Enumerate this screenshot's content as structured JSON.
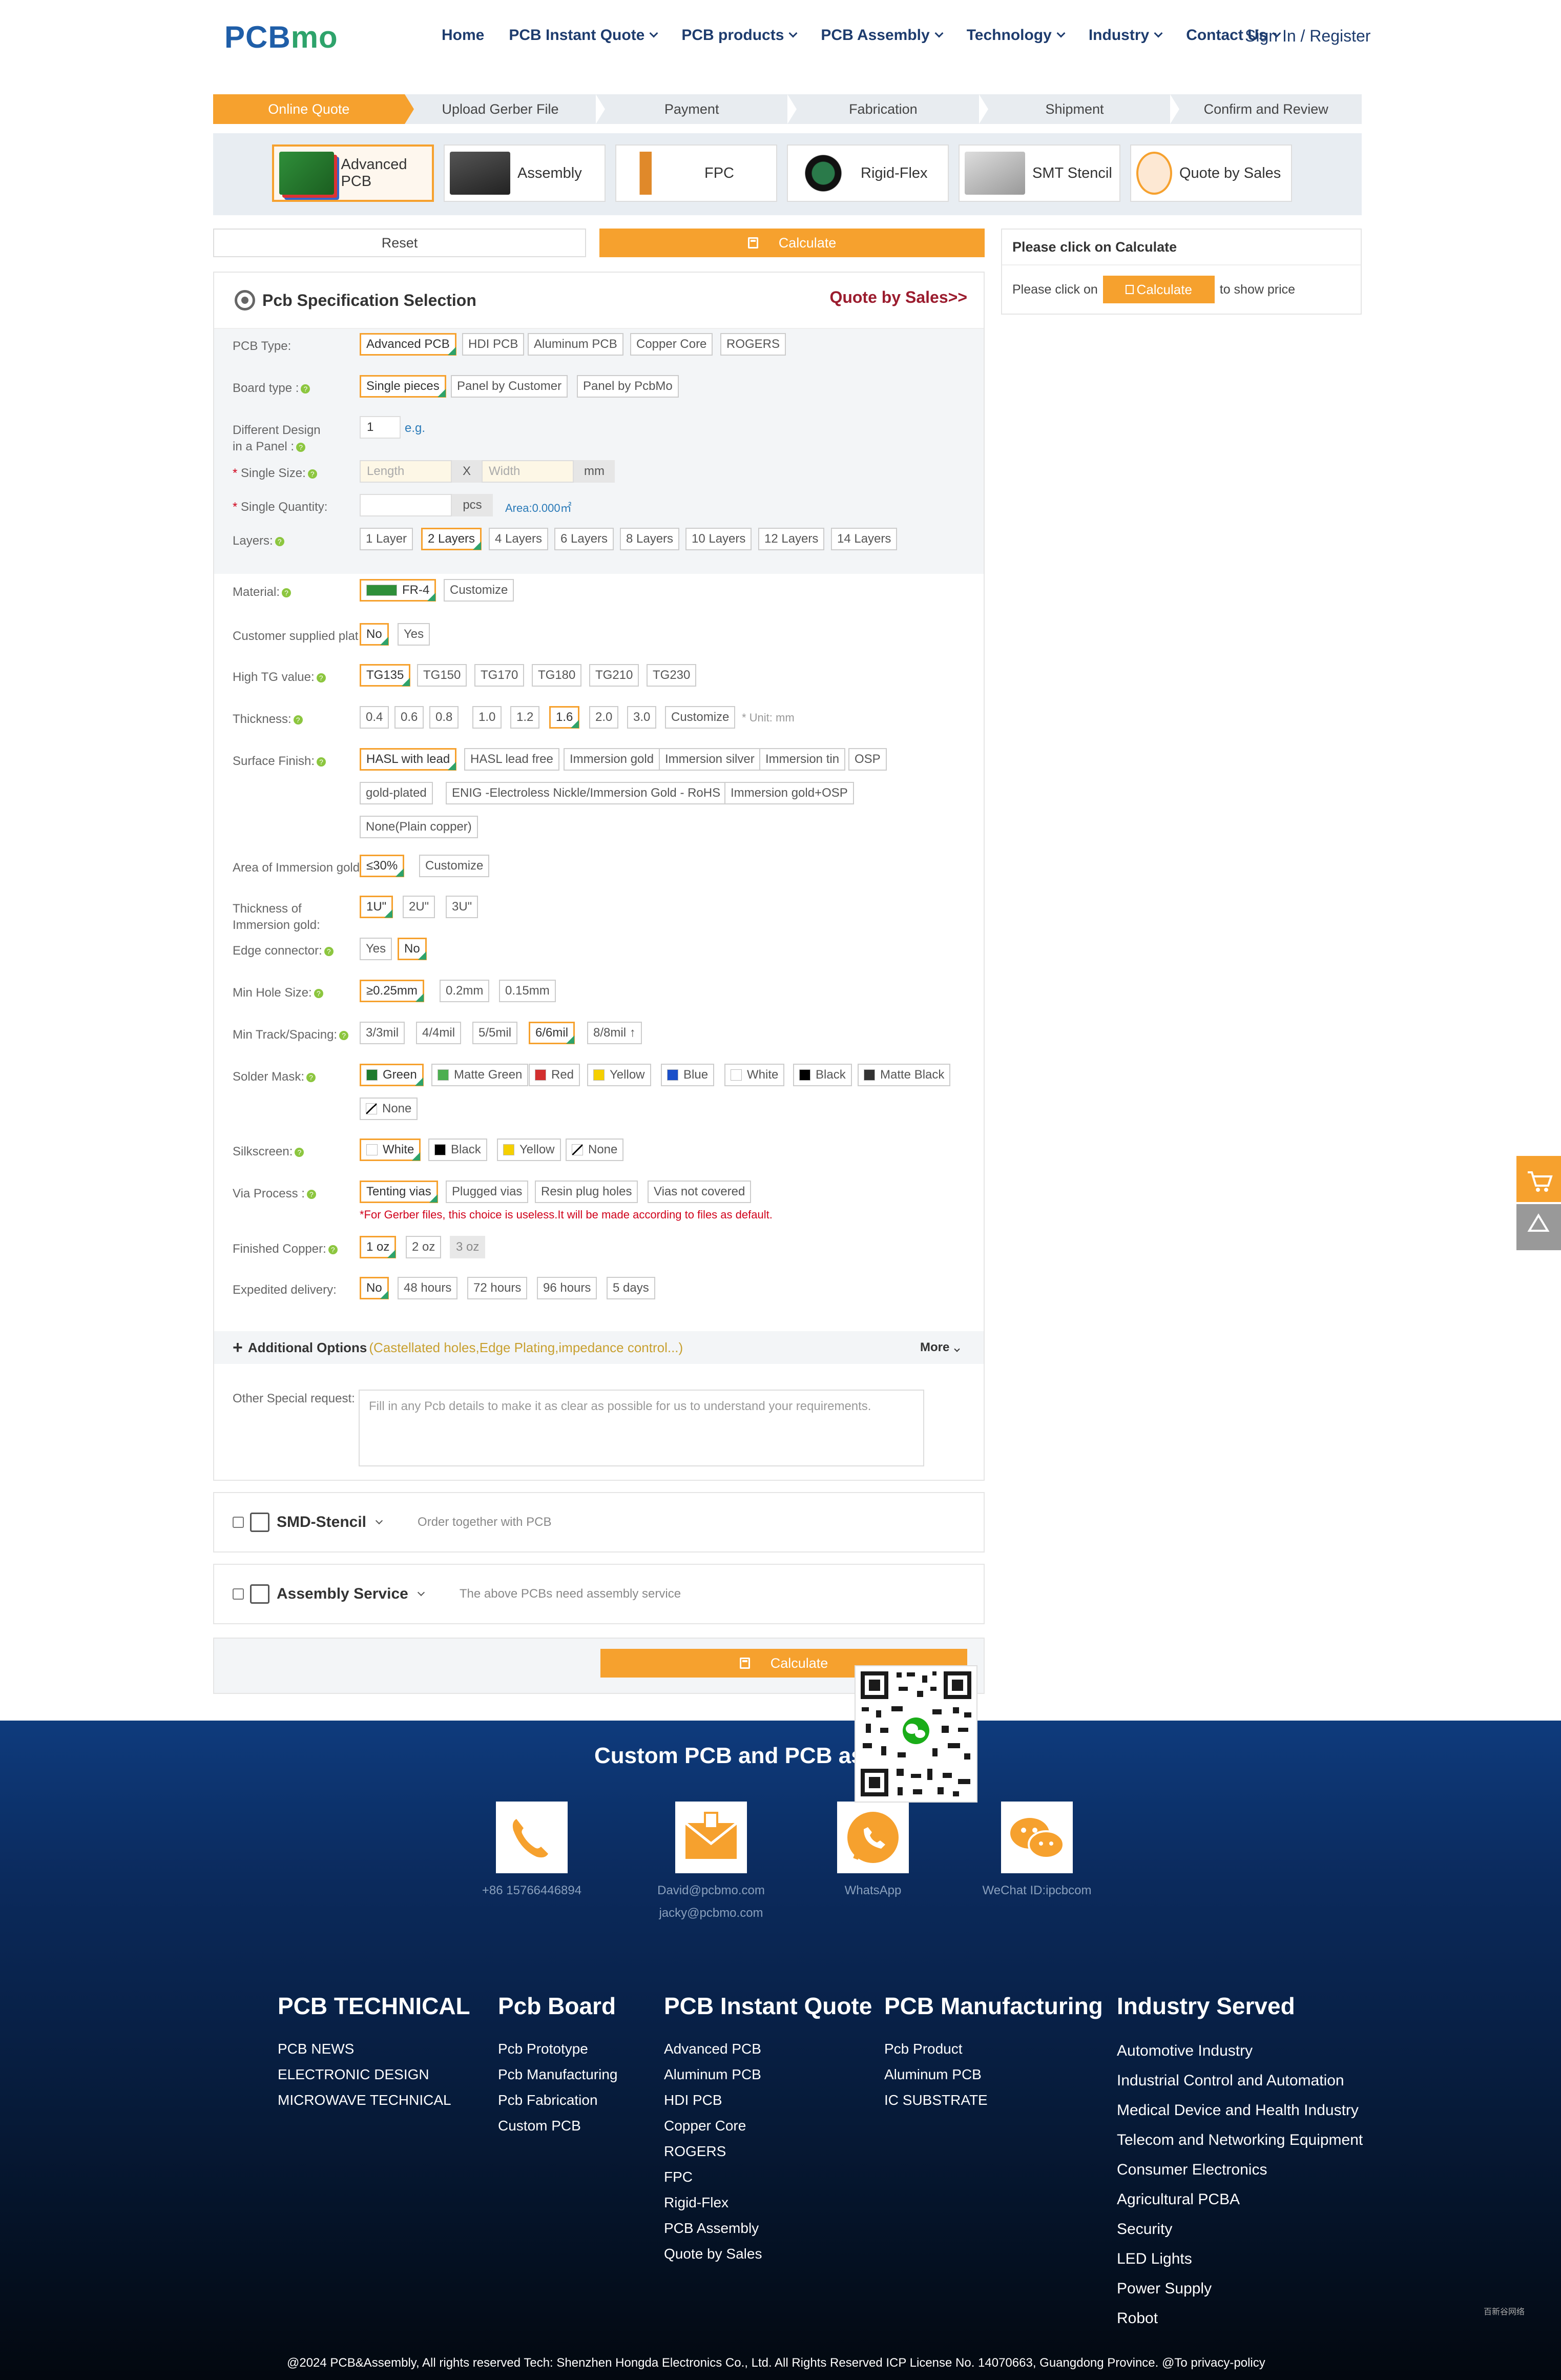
{
  "header": {
    "logo_a": "PCB",
    "logo_b": "mo",
    "nav": [
      "Home",
      "PCB Instant Quote",
      "PCB products",
      "PCB Assembly",
      "Technology",
      "Industry",
      "Contact Us"
    ],
    "signin": "Sign In / Register"
  },
  "steps": [
    "Online Quote",
    "Upload Gerber File",
    "Payment",
    "Fabrication",
    "Shipment",
    "Confirm and Review"
  ],
  "product_tabs": [
    "Advanced PCB",
    "Assembly",
    "FPC",
    "Rigid-Flex",
    "SMT Stencil",
    "Quote by Sales"
  ],
  "actions": {
    "reset": "Reset",
    "calculate": "Calculate"
  },
  "spec": {
    "title": "Pcb Specification Selection",
    "quote_by_sales": "Quote by Sales>>",
    "pcb_type": {
      "label": "PCB Type:",
      "options": [
        "Advanced PCB",
        "HDI PCB",
        "Aluminum PCB",
        "Copper Core",
        "ROGERS"
      ]
    },
    "board_type": {
      "label": "Board type :",
      "options": [
        "Single pieces",
        "Panel by Customer",
        "Panel by PcbMo"
      ]
    },
    "diff_design": {
      "label_1": "Different Design",
      "label_2": "in a Panel :",
      "value": "1",
      "eg": "e.g."
    },
    "single_size": {
      "label": "Single Size:",
      "length": "Length",
      "x": "X",
      "width": "Width",
      "unit": "mm"
    },
    "single_qty": {
      "label": "Single Quantity:",
      "unit": "pcs",
      "area": "Area:0.000㎡"
    },
    "layers": {
      "label": "Layers:",
      "options": [
        "1 Layer",
        "2 Layers",
        "4 Layers",
        "6 Layers",
        "8 Layers",
        "10 Layers",
        "12 Layers",
        "14 Layers"
      ]
    },
    "material": {
      "label": "Material:",
      "options": [
        "FR-4",
        "Customize"
      ]
    },
    "customer_plate": {
      "label": "Customer supplied plat",
      "options": [
        "No",
        "Yes"
      ]
    },
    "high_tg": {
      "label": "High TG value:",
      "options": [
        "TG135",
        "TG150",
        "TG170",
        "TG180",
        "TG210",
        "TG230"
      ]
    },
    "thickness": {
      "label": "Thickness:",
      "options": [
        "0.4",
        "0.6",
        "0.8",
        "1.0",
        "1.2",
        "1.6",
        "2.0",
        "3.0",
        "Customize"
      ],
      "note": "* Unit: mm"
    },
    "surface": {
      "label": "Surface Finish:",
      "options": [
        "HASL with lead",
        "HASL lead free",
        "Immersion gold",
        "Immersion silver",
        "Immersion tin",
        "OSP",
        "gold-plated",
        "ENIG -Electroless Nickle/Immersion Gold - RoHS",
        "Immersion gold+OSP",
        "None(Plain copper)"
      ]
    },
    "area_gold": {
      "label": "Area of Immersion gold:",
      "options": [
        "≤30%",
        "Customize"
      ]
    },
    "thick_gold": {
      "label_1": "Thickness of",
      "label_2": "Immersion gold:",
      "options": [
        "1U\"",
        "2U\"",
        "3U\""
      ]
    },
    "edge": {
      "label": "Edge connector:",
      "options": [
        "Yes",
        "No"
      ]
    },
    "min_hole": {
      "label": "Min Hole Size:",
      "options": [
        "≥0.25mm",
        "0.2mm",
        "0.15mm"
      ]
    },
    "min_track": {
      "label": "Min Track/Spacing:",
      "options": [
        "3/3mil",
        "4/4mil",
        "5/5mil",
        "6/6mil",
        "8/8mil ↑"
      ]
    },
    "solder": {
      "label": "Solder Mask:",
      "options": [
        "Green",
        "Matte Green",
        "Red",
        "Yellow",
        "Blue",
        "White",
        "Black",
        "Matte Black",
        "None"
      ]
    },
    "silk": {
      "label": "Silkscreen:",
      "options": [
        "White",
        "Black",
        "Yellow",
        "None"
      ]
    },
    "via": {
      "label": "Via Process :",
      "options": [
        "Tenting vias",
        "Plugged vias",
        "Resin plug holes",
        "Vias not covered"
      ],
      "note": "*For Gerber files, this choice is useless.It will be made according to files as default."
    },
    "copper": {
      "label": "Finished Copper:",
      "options": [
        "1 oz",
        "2 oz",
        "3 oz"
      ]
    },
    "expedited": {
      "label": "Expedited delivery:",
      "options": [
        "No",
        "48 hours",
        "72 hours",
        "96 hours",
        "5 days"
      ]
    },
    "additional": {
      "title": "Additional Options",
      "hint": "(Castellated holes,Edge Plating,impedance control...)",
      "more": "More"
    },
    "special": {
      "label": "Other Special request:",
      "placeholder": "Fill in any Pcb details to make it as clear as possible for us to understand your requirements."
    }
  },
  "smd": {
    "title": "SMD-Stencil",
    "desc": "Order together with PCB"
  },
  "assembly": {
    "title": "Assembly Service",
    "desc": "The above PCBs need assembly service"
  },
  "price": {
    "title": "Please click on Calculate",
    "pre": "Please click on",
    "btn": "Calculate",
    "post": "to show price"
  },
  "footer": {
    "title": "Custom PCB and PCB assembly",
    "phone": "+86 15766446894",
    "email_1": "David@pcbmo.com",
    "email_2": "jacky@pcbmo.com",
    "whatsapp": "WhatsApp",
    "wechat": "WeChat ID:ipcbcom",
    "cols": [
      {
        "title": "PCB TECHNICAL",
        "items": [
          "PCB NEWS",
          "ELECTRONIC DESIGN",
          "MICROWAVE TECHNICAL"
        ]
      },
      {
        "title": "Pcb Board",
        "items": [
          "Pcb Prototype",
          "Pcb Manufacturing",
          "Pcb Fabrication",
          "Custom PCB"
        ]
      },
      {
        "title": "PCB Instant Quote",
        "items": [
          "Advanced PCB",
          "Aluminum PCB",
          "HDI PCB",
          "Copper Core",
          "ROGERS",
          "FPC",
          "Rigid-Flex",
          "PCB Assembly",
          "Quote by Sales"
        ]
      },
      {
        "title": "PCB Manufacturing",
        "items": [
          "Pcb Product",
          "Aluminum PCB",
          "IC SUBSTRATE"
        ]
      },
      {
        "title": "Industry Served",
        "items": [
          "Automotive Industry",
          "Industrial Control and Automation",
          "Medical Device and Health Industry",
          "Telecom and Networking Equipment",
          "Consumer Electronics",
          "Agricultural PCBA",
          "Security",
          "LED Lights",
          "Power Supply",
          "Robot"
        ]
      }
    ],
    "copyright": "@2024 PCB&Assembly, All rights reserved Tech: Shenzhen Hongda Electronics Co., Ltd. All Rights Reserved ICP License No. 14070663, Guangdong Province. @To privacy-policy",
    "brand": "百新谷网络"
  },
  "colors": {
    "accent": "#f6a12e",
    "selected_check": "#2ea36b",
    "footer_top": "#0e3b7d",
    "brand_red": "#9b1c2e"
  }
}
